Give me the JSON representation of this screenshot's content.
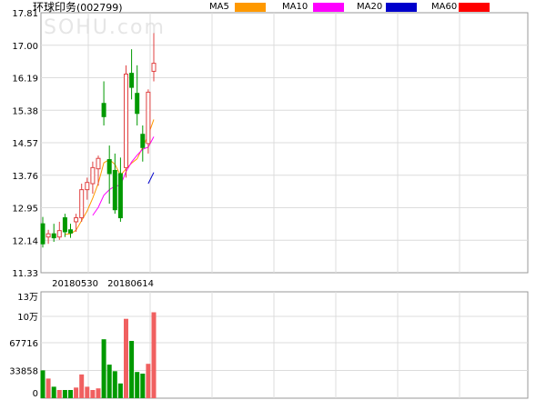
{
  "header": {
    "title_cn": "环球印务",
    "title_code": "(002799)",
    "watermark": "SOHU.com"
  },
  "legend": [
    {
      "label": "MA5",
      "color": "#ff9900"
    },
    {
      "label": "MA10",
      "color": "#ff00ff"
    },
    {
      "label": "MA20",
      "color": "#0000cc"
    },
    {
      "label": "MA60",
      "color": "#ff0000"
    }
  ],
  "chart_data": [
    {
      "type": "candlestick",
      "ylim": [
        11.33,
        17.81
      ],
      "yticks": [
        "17.81",
        "17.00",
        "16.19",
        "15.38",
        "14.57",
        "13.76",
        "12.95",
        "12.14",
        "11.33"
      ],
      "xticks": [
        {
          "index": 10,
          "label": "20180530"
        },
        {
          "index": 20,
          "label": "20180614"
        }
      ],
      "up_color": "#e04040",
      "down_color": "#009900",
      "candles": [
        {
          "o": 12.55,
          "h": 12.72,
          "l": 11.96,
          "c": 12.05
        },
        {
          "o": 12.22,
          "h": 12.4,
          "l": 12.05,
          "c": 12.3
        },
        {
          "o": 12.3,
          "h": 12.55,
          "l": 12.1,
          "c": 12.2
        },
        {
          "o": 12.22,
          "h": 12.6,
          "l": 12.15,
          "c": 12.38
        },
        {
          "o": 12.7,
          "h": 12.8,
          "l": 12.22,
          "c": 12.35
        },
        {
          "o": 12.4,
          "h": 12.55,
          "l": 12.2,
          "c": 12.32
        },
        {
          "o": 12.6,
          "h": 12.8,
          "l": 12.35,
          "c": 12.7
        },
        {
          "o": 12.7,
          "h": 13.55,
          "l": 12.6,
          "c": 13.4
        },
        {
          "o": 13.4,
          "h": 13.7,
          "l": 13.15,
          "c": 13.58
        },
        {
          "o": 13.55,
          "h": 14.1,
          "l": 13.3,
          "c": 13.95
        },
        {
          "o": 13.92,
          "h": 14.25,
          "l": 13.5,
          "c": 14.18
        },
        {
          "o": 15.55,
          "h": 16.1,
          "l": 15.0,
          "c": 15.22
        },
        {
          "o": 14.15,
          "h": 14.5,
          "l": 13.05,
          "c": 13.8
        },
        {
          "o": 13.88,
          "h": 14.3,
          "l": 12.8,
          "c": 12.9
        },
        {
          "o": 13.8,
          "h": 14.2,
          "l": 12.6,
          "c": 12.7
        },
        {
          "o": 13.95,
          "h": 16.5,
          "l": 13.7,
          "c": 16.28
        },
        {
          "o": 16.3,
          "h": 16.9,
          "l": 15.65,
          "c": 15.95
        },
        {
          "o": 15.8,
          "h": 16.5,
          "l": 15.0,
          "c": 15.3
        },
        {
          "o": 14.78,
          "h": 15.0,
          "l": 14.1,
          "c": 14.45
        },
        {
          "o": 14.55,
          "h": 15.9,
          "l": 14.3,
          "c": 15.83
        },
        {
          "o": 16.35,
          "h": 17.3,
          "l": 16.1,
          "c": 16.55
        }
      ],
      "ma5": [
        null,
        null,
        null,
        null,
        12.29,
        12.3,
        12.39,
        12.63,
        12.87,
        13.19,
        13.56,
        14.07,
        14.15,
        14.03,
        13.76,
        13.92,
        14.06,
        14.17,
        14.46,
        14.76,
        15.15
      ],
      "ma10": [
        null,
        null,
        null,
        null,
        null,
        null,
        null,
        null,
        null,
        12.76,
        12.96,
        13.26,
        13.4,
        13.49,
        13.51,
        13.85,
        14.09,
        14.26,
        14.41,
        14.46,
        14.72
      ],
      "ma20": [
        null,
        null,
        null,
        null,
        null,
        null,
        null,
        null,
        null,
        null,
        null,
        null,
        null,
        null,
        null,
        null,
        null,
        null,
        null,
        13.55,
        13.83
      ]
    },
    {
      "type": "bar",
      "ylim": [
        0,
        130000
      ],
      "yticks": [
        "13万",
        "10万",
        "67716",
        "33858",
        "0"
      ],
      "values": [
        34000,
        24000,
        14000,
        10000,
        10000,
        10000,
        13000,
        29000,
        14000,
        10000,
        12000,
        72000,
        41000,
        33000,
        18000,
        97000,
        70000,
        32000,
        30000,
        42000,
        105000
      ]
    }
  ]
}
